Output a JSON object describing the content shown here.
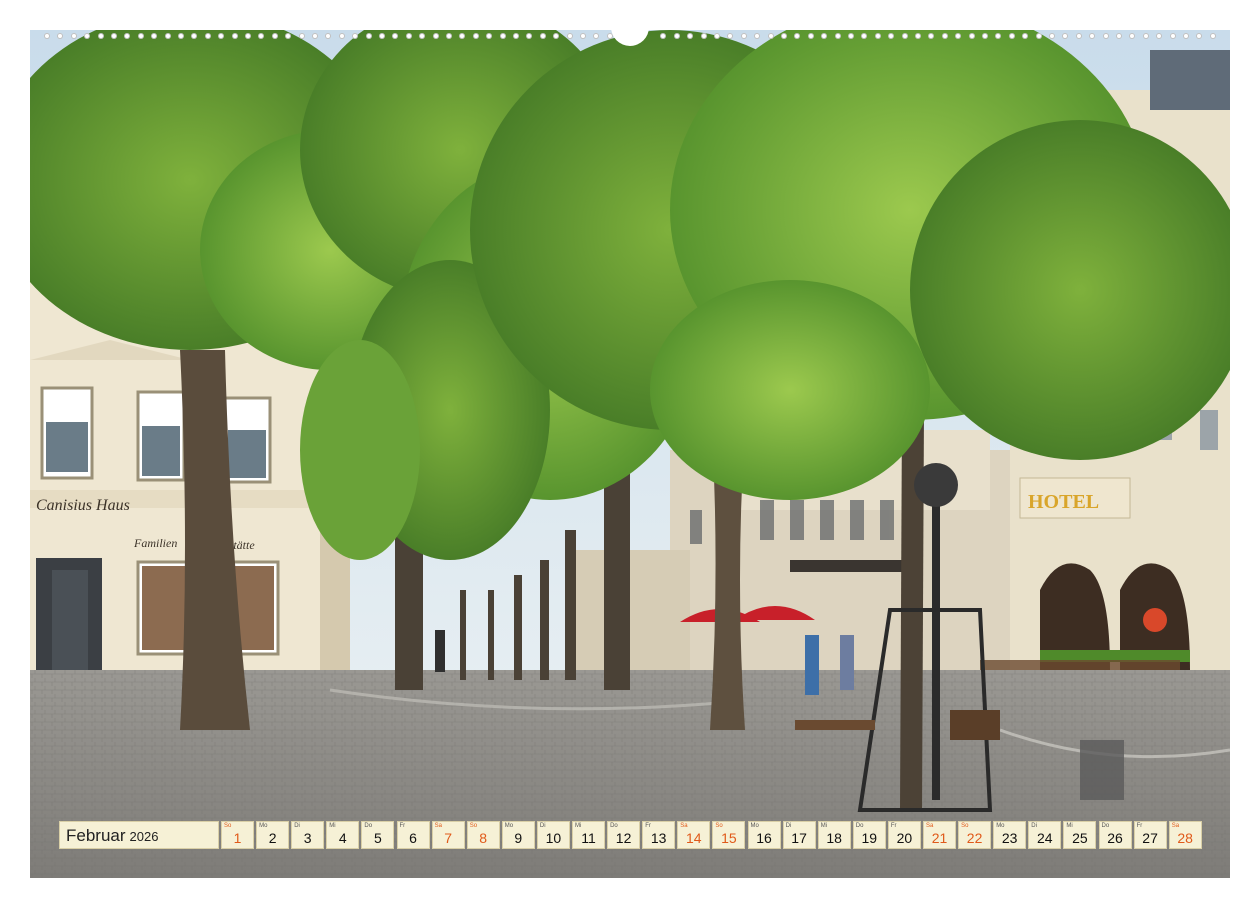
{
  "calendar": {
    "month": "Februar",
    "year": "2026",
    "days": [
      {
        "dow": "So",
        "num": "1",
        "weekend": true
      },
      {
        "dow": "Mo",
        "num": "2",
        "weekend": false
      },
      {
        "dow": "Di",
        "num": "3",
        "weekend": false
      },
      {
        "dow": "Mi",
        "num": "4",
        "weekend": false
      },
      {
        "dow": "Do",
        "num": "5",
        "weekend": false
      },
      {
        "dow": "Fr",
        "num": "6",
        "weekend": false
      },
      {
        "dow": "Sa",
        "num": "7",
        "weekend": true
      },
      {
        "dow": "So",
        "num": "8",
        "weekend": true
      },
      {
        "dow": "Mo",
        "num": "9",
        "weekend": false
      },
      {
        "dow": "Di",
        "num": "10",
        "weekend": false
      },
      {
        "dow": "Mi",
        "num": "11",
        "weekend": false
      },
      {
        "dow": "Do",
        "num": "12",
        "weekend": false
      },
      {
        "dow": "Fr",
        "num": "13",
        "weekend": false
      },
      {
        "dow": "Sa",
        "num": "14",
        "weekend": true
      },
      {
        "dow": "So",
        "num": "15",
        "weekend": true
      },
      {
        "dow": "Mo",
        "num": "16",
        "weekend": false
      },
      {
        "dow": "Di",
        "num": "17",
        "weekend": false
      },
      {
        "dow": "Mi",
        "num": "18",
        "weekend": false
      },
      {
        "dow": "Do",
        "num": "19",
        "weekend": false
      },
      {
        "dow": "Fr",
        "num": "20",
        "weekend": false
      },
      {
        "dow": "Sa",
        "num": "21",
        "weekend": true
      },
      {
        "dow": "So",
        "num": "22",
        "weekend": true
      },
      {
        "dow": "Mo",
        "num": "23",
        "weekend": false
      },
      {
        "dow": "Di",
        "num": "24",
        "weekend": false
      },
      {
        "dow": "Mi",
        "num": "25",
        "weekend": false
      },
      {
        "dow": "Do",
        "num": "26",
        "weekend": false
      },
      {
        "dow": "Fr",
        "num": "27",
        "weekend": false
      },
      {
        "dow": "Sa",
        "num": "28",
        "weekend": true
      }
    ]
  },
  "photo": {
    "sign_canisius": "Canisius Haus",
    "sign_familien": "Familien",
    "sign_gaststaette": "gsstätte",
    "sign_hotel": "HOTEL"
  },
  "colors": {
    "weekend": "#e05a1a",
    "cell_bg": "#f6f1d6",
    "foliage": "#4f8a2a",
    "pavement": "#8d8c88"
  }
}
